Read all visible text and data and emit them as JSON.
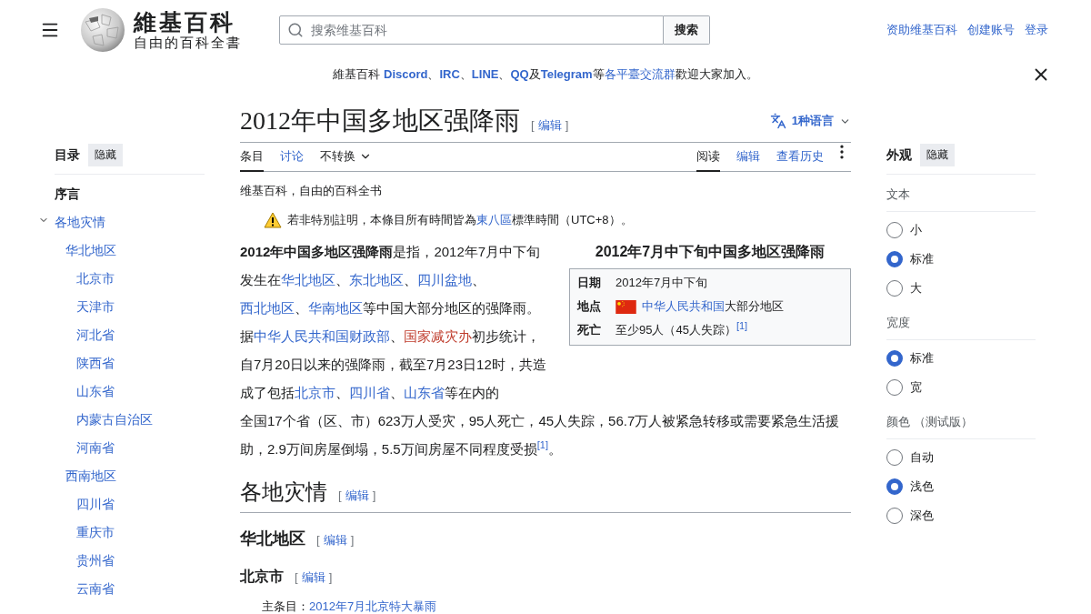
{
  "header": {
    "wordmark": "維基百科",
    "tagline": "自由的百科全書",
    "search": {
      "placeholder": "搜索维基百科",
      "button": "搜索"
    },
    "user_links": [
      "资助维基百科",
      "创建账号",
      "登录"
    ]
  },
  "banner": {
    "segments": [
      {
        "t": "維基百科 ",
        "kind": "plain"
      },
      {
        "t": "Discord",
        "kind": "strong-link"
      },
      {
        "t": "、",
        "kind": "plain"
      },
      {
        "t": "IRC",
        "kind": "strong-link"
      },
      {
        "t": "、",
        "kind": "plain"
      },
      {
        "t": "LINE",
        "kind": "strong-link"
      },
      {
        "t": "、",
        "kind": "plain"
      },
      {
        "t": "QQ",
        "kind": "strong-link"
      },
      {
        "t": "及",
        "kind": "plain"
      },
      {
        "t": "Telegram",
        "kind": "strong-link"
      },
      {
        "t": "等",
        "kind": "plain"
      },
      {
        "t": "各平臺交流群",
        "kind": "link"
      },
      {
        "t": "歡迎大家加入。",
        "kind": "plain"
      }
    ]
  },
  "toc": {
    "title": "目录",
    "hide": "隐藏",
    "items": [
      {
        "label": "序言",
        "selected": true
      },
      {
        "label": "各地灾情",
        "selected": false,
        "expanded": true,
        "children": [
          {
            "label": "华北地区",
            "selected": false,
            "children": [
              {
                "label": "北京市",
                "selected": false
              },
              {
                "label": "天津市",
                "selected": false
              },
              {
                "label": "河北省",
                "selected": false
              },
              {
                "label": "陕西省",
                "selected": false
              },
              {
                "label": "山东省",
                "selected": false
              },
              {
                "label": "内蒙古自治区",
                "selected": false
              },
              {
                "label": "河南省",
                "selected": false
              }
            ]
          },
          {
            "label": "西南地区",
            "selected": false,
            "children": [
              {
                "label": "四川省",
                "selected": false
              },
              {
                "label": "重庆市",
                "selected": false
              },
              {
                "label": "贵州省",
                "selected": false
              },
              {
                "label": "云南省",
                "selected": false
              }
            ]
          }
        ]
      }
    ]
  },
  "article": {
    "title": "2012年中国多地区强降雨",
    "title_edit": [
      "[",
      "编辑",
      "]"
    ],
    "languages": "1种语言",
    "tabs_left": [
      {
        "label": "条目",
        "kind": "tab",
        "selected": true
      },
      {
        "label": "讨论",
        "kind": "tab",
        "selected": false
      },
      {
        "label": "不转换",
        "kind": "dropdown",
        "selected": false
      }
    ],
    "tabs_right": [
      {
        "label": "阅读",
        "selected": true
      },
      {
        "label": "编辑",
        "selected": false
      },
      {
        "label": "查看历史",
        "selected": false
      }
    ],
    "tagline": "维基百科，自由的百科全书",
    "notice": [
      {
        "t": "若非特別註明，本條目所有時間皆為",
        "kind": "plain"
      },
      {
        "t": "東八區",
        "kind": "link"
      },
      {
        "t": "標準時間（UTC+8）。",
        "kind": "plain"
      }
    ],
    "infobox": {
      "title": "2012年7月中下旬中国多地区强降雨",
      "rows": [
        {
          "label": "日期",
          "flag": false,
          "value": [
            {
              "t": "2012年7月中下旬",
              "kind": "plain"
            }
          ]
        },
        {
          "label": "地点",
          "flag": true,
          "value": [
            {
              "t": "中华人民共和国",
              "kind": "link"
            },
            {
              "t": "大部分地区",
              "kind": "plain"
            }
          ]
        },
        {
          "label": "死亡",
          "flag": false,
          "value": [
            {
              "t": "至少95人（45人失踪）",
              "kind": "plain"
            },
            {
              "t": "[1]",
              "kind": "ref"
            }
          ]
        }
      ]
    },
    "lead": [
      [
        {
          "t": "2012年中国多地区强降雨",
          "kind": "bold"
        },
        {
          "t": "是指，2012年7月中下旬发生在",
          "kind": "plain"
        },
        {
          "t": "华北地区",
          "kind": "link"
        },
        {
          "t": "、",
          "kind": "plain"
        },
        {
          "t": "东北地区",
          "kind": "link"
        },
        {
          "t": "、",
          "kind": "plain"
        },
        {
          "t": "四川盆地",
          "kind": "link"
        },
        {
          "t": "、",
          "kind": "plain"
        },
        {
          "t": "西北地区",
          "kind": "link"
        },
        {
          "t": "、",
          "kind": "plain"
        },
        {
          "t": "华南地区",
          "kind": "link"
        },
        {
          "t": "等中国大部分地区的强降雨。据",
          "kind": "plain"
        },
        {
          "t": "中华人民共和国财政部",
          "kind": "link"
        },
        {
          "t": "、",
          "kind": "plain"
        },
        {
          "t": "国家减灾办",
          "kind": "redlink"
        },
        {
          "t": "初步统计，自7月20日以来的强降雨，截至7月23日12时，共造成了包括",
          "kind": "plain"
        },
        {
          "t": "北京市",
          "kind": "link"
        },
        {
          "t": "、",
          "kind": "plain"
        },
        {
          "t": "四川省",
          "kind": "link"
        },
        {
          "t": "、",
          "kind": "plain"
        },
        {
          "t": "山东省",
          "kind": "link"
        },
        {
          "t": "等在内的",
          "kind": "plain"
        }
      ],
      [
        {
          "t": "全国17个省（区、市）623万人受灾，95人死亡，45人失踪，56.7万人被紧急转移或需要紧急生活援助，2.9万间房屋倒塌，5.5万间房屋不同程度受损",
          "kind": "plain"
        },
        {
          "t": "[1]",
          "kind": "ref"
        },
        {
          "t": "。",
          "kind": "plain"
        }
      ]
    ],
    "sections": [
      {
        "kind": "h2",
        "title": "各地灾情",
        "edit": [
          "[",
          "编辑",
          "]"
        ]
      },
      {
        "kind": "h3",
        "title": "华北地区",
        "edit": [
          "[",
          "编辑",
          "]"
        ]
      },
      {
        "kind": "h4",
        "title": "北京市",
        "edit": [
          "[",
          "编辑",
          "]"
        ]
      },
      {
        "kind": "hatnote",
        "segments": [
          {
            "t": "主条目：",
            "kind": "plain"
          },
          {
            "t": "2012年7月北京特大暴雨",
            "kind": "link"
          }
        ]
      }
    ]
  },
  "appearance": {
    "title": "外观",
    "hide": "隐藏",
    "groups": [
      {
        "label": "文本",
        "options": [
          {
            "label": "小",
            "selected": false
          },
          {
            "label": "标准",
            "selected": true
          },
          {
            "label": "大",
            "selected": false
          }
        ]
      },
      {
        "label": "宽度",
        "options": [
          {
            "label": "标准",
            "selected": true
          },
          {
            "label": "宽",
            "selected": false
          }
        ]
      },
      {
        "label": "颜色 （测试版）",
        "options": [
          {
            "label": "自动",
            "selected": false
          },
          {
            "label": "浅色",
            "selected": true
          },
          {
            "label": "深色",
            "selected": false
          }
        ]
      }
    ]
  }
}
